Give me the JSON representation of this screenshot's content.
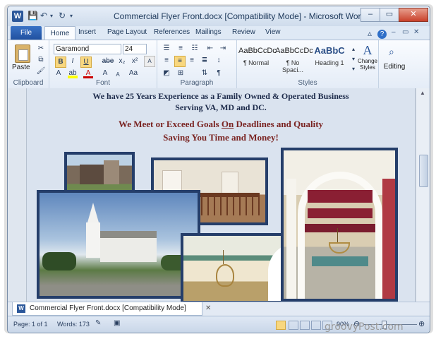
{
  "window": {
    "title": "Commercial Flyer Front.docx [Compatibility Mode]  -  Microsoft Word",
    "logo_letter": "W",
    "controls": {
      "minimize": "–",
      "maximize": "▭",
      "close": "✕"
    }
  },
  "tabs": [
    "File",
    "Home",
    "Insert",
    "Page Layout",
    "References",
    "Mailings",
    "Review",
    "View"
  ],
  "ribbon": {
    "clipboard": {
      "label": "Clipboard",
      "paste": "Paste"
    },
    "font": {
      "label": "Font",
      "family": "Garamond",
      "size": "24",
      "bold": "B",
      "italic": "I",
      "underline": "U",
      "strike": "abe",
      "sub": "x₂",
      "sup": "x²",
      "grow": "A",
      "shrink": "A",
      "case": "Aa"
    },
    "paragraph": {
      "label": "Paragraph",
      "pilcrow": "¶"
    },
    "styles": {
      "label": "Styles",
      "items": [
        {
          "preview": "AaBbCcDc",
          "name": "¶ Normal"
        },
        {
          "preview": "AaBbCcDc",
          "name": "¶ No Spaci..."
        },
        {
          "preview": "AaBbC",
          "name": "Heading 1"
        }
      ],
      "change_styles": "Change Styles"
    },
    "editing": {
      "label": "Editing"
    }
  },
  "document": {
    "line1": "We have 25 Years Experience as a Family Owned & Operated Business",
    "line2": "Serving VA, MD and DC.",
    "line3_a": "We Meet or Exceed Goals ",
    "line3_b": "On",
    "line3_c": " Deadlines and Quality",
    "line4": "Saving You Time and Money!"
  },
  "doc_tab": {
    "name": "Commercial Flyer Front.docx [Compatibility Mode]"
  },
  "status": {
    "page": "Page: 1 of 1",
    "words": "Words: 173",
    "zoom": "90%"
  },
  "colors": {
    "accent": "#2b579a",
    "frame": "#253e6a",
    "headline": "#7a2422"
  },
  "watermark": "groovyPost.com"
}
